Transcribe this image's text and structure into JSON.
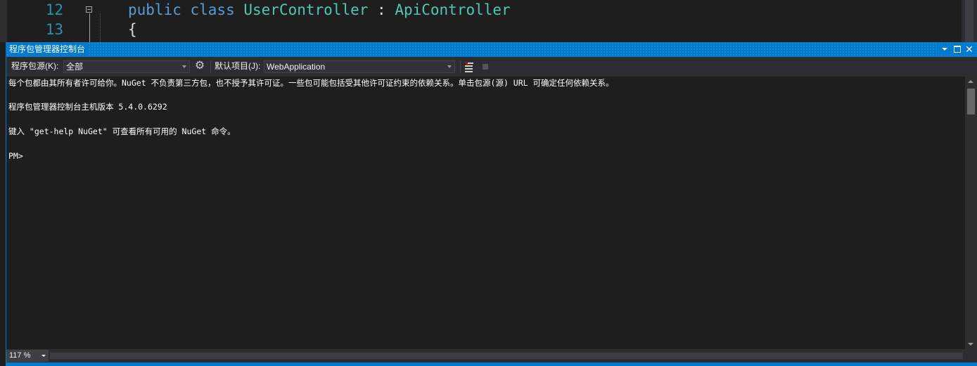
{
  "editor": {
    "lines": [
      {
        "number": "12",
        "code_keyword": "public class",
        "code_type": "UserController",
        "code_sep": " : ",
        "code_base": "ApiController"
      },
      {
        "number": "13",
        "code_plain": "{"
      }
    ]
  },
  "window": {
    "title": "程序包管理器控制台",
    "buttons": {
      "dropdown": "window-position-menu",
      "maximize": "maximize",
      "close": "✕"
    }
  },
  "toolbar": {
    "source_label": "程序包源(K):",
    "source_value": "全部",
    "settings_icon": "gear-icon",
    "project_label": "默认项目(J):",
    "project_value": "WebApplication",
    "clear_icon": "clear-console-icon",
    "stop_icon": "stop-icon"
  },
  "console": {
    "lines": [
      "每个包都由其所有者许可给你。NuGet 不负责第三方包，也不授予其许可证。一些包可能包括受其他许可证约束的依赖关系。单击包源(源) URL 可确定任何依赖关系。",
      "程序包管理器控制台主机版本 5.4.0.6292",
      "键入 \"get-help NuGet\" 可查看所有可用的 NuGet 命令。",
      "PM>"
    ]
  },
  "status": {
    "zoom": "117 %"
  },
  "colors": {
    "accent": "#007acc",
    "background": "#1e1e1e",
    "toolbar": "#2d2d30",
    "keyword": "#569cd6",
    "type": "#4ec9b0",
    "line_number": "#2b91af"
  }
}
